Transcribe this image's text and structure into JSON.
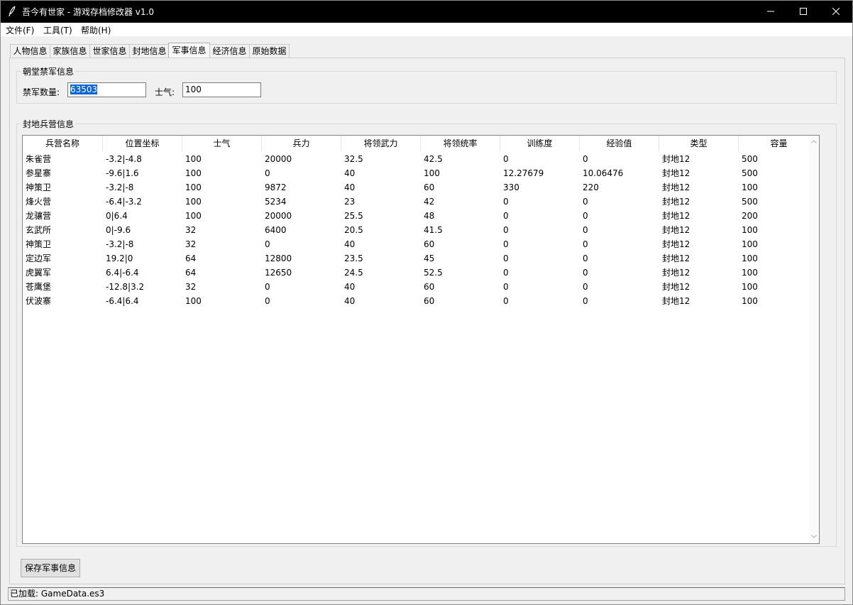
{
  "window": {
    "title": "吾今有世家 - 游戏存档修改器 v1.0"
  },
  "menu": [
    "文件(F)",
    "工具(T)",
    "帮助(H)"
  ],
  "tabs": [
    {
      "label": "人物信息",
      "active": false
    },
    {
      "label": "家族信息",
      "active": false
    },
    {
      "label": "世家信息",
      "active": false
    },
    {
      "label": "封地信息",
      "active": false
    },
    {
      "label": "军事信息",
      "active": true
    },
    {
      "label": "经济信息",
      "active": false
    },
    {
      "label": "原始数据",
      "active": false
    }
  ],
  "court_guard": {
    "title": "朝堂禁军信息",
    "count_label": "禁军数量:",
    "count_value": "63503",
    "morale_label": "士气:",
    "morale_value": "100"
  },
  "barracks": {
    "title": "封地兵营信息",
    "columns": [
      "兵营名称",
      "位置坐标",
      "士气",
      "兵力",
      "将领武力",
      "将领统率",
      "训练度",
      "经验值",
      "类型",
      "容量"
    ],
    "rows": [
      [
        "朱雀营",
        "-3.2|-4.8",
        "100",
        "20000",
        "32.5",
        "42.5",
        "0",
        "0",
        "封地12",
        "500"
      ],
      [
        "参星寨",
        "-9.6|1.6",
        "100",
        "0",
        "40",
        "100",
        "12.27679",
        "10.06476",
        "封地12",
        "500"
      ],
      [
        "神策卫",
        "-3.2|-8",
        "100",
        "9872",
        "40",
        "60",
        "330",
        "220",
        "封地12",
        "100"
      ],
      [
        "烽火营",
        "-6.4|-3.2",
        "100",
        "5234",
        "23",
        "42",
        "0",
        "0",
        "封地12",
        "500"
      ],
      [
        "龙骧营",
        "0|6.4",
        "100",
        "20000",
        "25.5",
        "48",
        "0",
        "0",
        "封地12",
        "200"
      ],
      [
        "玄武所",
        "0|-9.6",
        "32",
        "6400",
        "20.5",
        "41.5",
        "0",
        "0",
        "封地12",
        "100"
      ],
      [
        "神策卫",
        "-3.2|-8",
        "32",
        "0",
        "40",
        "60",
        "0",
        "0",
        "封地12",
        "100"
      ],
      [
        "定边军",
        "19.2|0",
        "64",
        "12800",
        "23.5",
        "45",
        "0",
        "0",
        "封地12",
        "100"
      ],
      [
        "虎翼军",
        "6.4|-6.4",
        "64",
        "12650",
        "24.5",
        "52.5",
        "0",
        "0",
        "封地12",
        "100"
      ],
      [
        "苍鹰堡",
        "-12.8|3.2",
        "32",
        "0",
        "40",
        "60",
        "0",
        "0",
        "封地12",
        "100"
      ],
      [
        "伏波寨",
        "-6.4|6.4",
        "100",
        "0",
        "40",
        "60",
        "0",
        "0",
        "封地12",
        "100"
      ]
    ]
  },
  "save_button": "保存军事信息",
  "status": "已加载: GameData.es3",
  "icons": {
    "app": "feather-icon",
    "minimize": "minimize-icon",
    "maximize": "maximize-icon",
    "close": "close-icon",
    "scroll_up": "chevron-up-icon",
    "scroll_down": "chevron-down-icon"
  },
  "colors": {
    "titlebar": "#000000",
    "selection": "#0a64d8"
  }
}
